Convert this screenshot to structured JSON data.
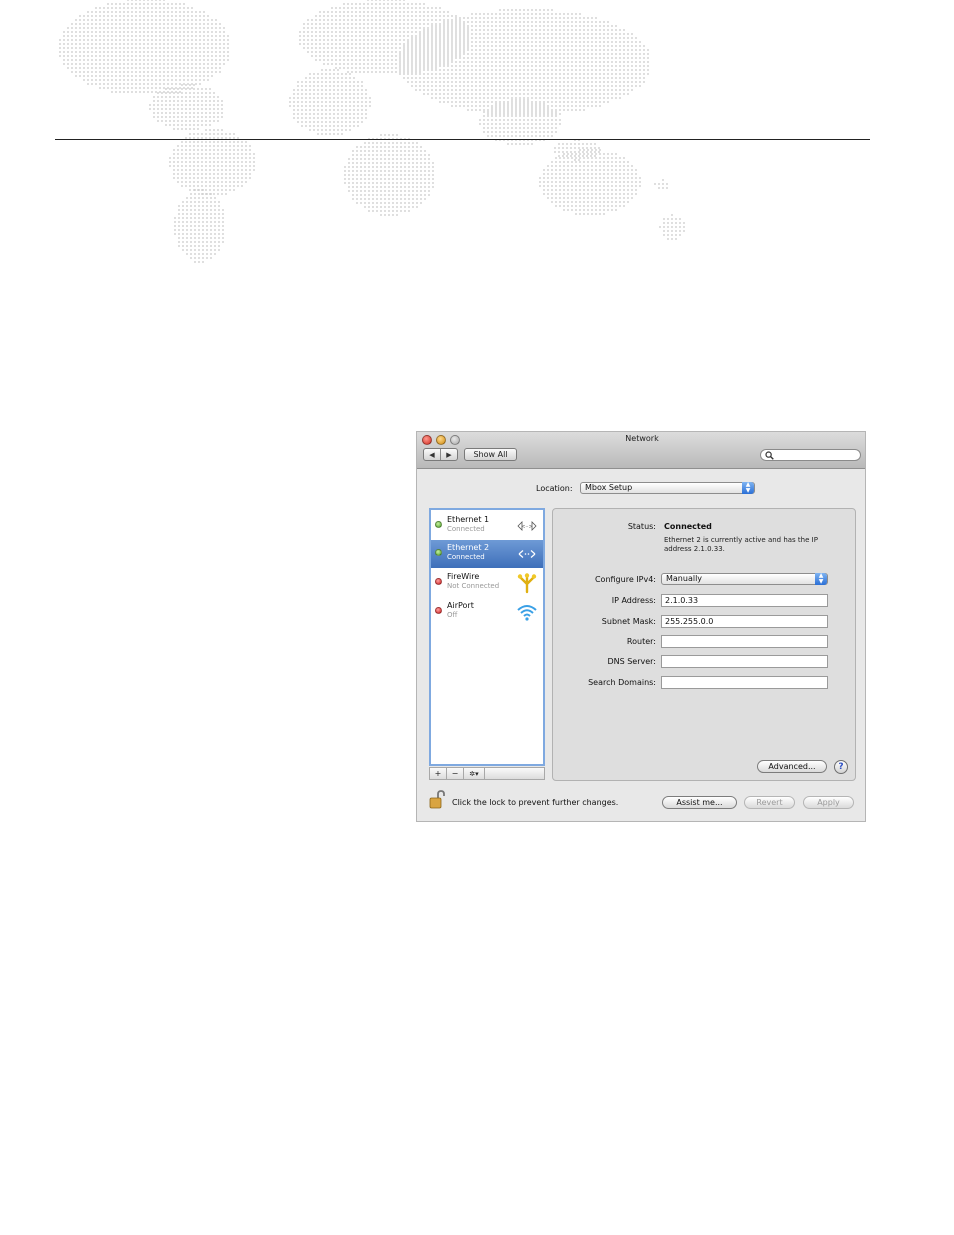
{
  "window": {
    "title": "Network",
    "toolbar": {
      "back": "◀",
      "forward": "▶",
      "show_all": "Show All",
      "search_placeholder": ""
    }
  },
  "location": {
    "label": "Location:",
    "value": "Mbox Setup"
  },
  "services": [
    {
      "name": "Ethernet 1",
      "status": "Connected",
      "indicator": "green",
      "icon": "ethernet-icon",
      "selected": false
    },
    {
      "name": "Ethernet 2",
      "status": "Connected",
      "indicator": "green",
      "icon": "ethernet-icon",
      "selected": true
    },
    {
      "name": "FireWire",
      "status": "Not Connected",
      "indicator": "red",
      "icon": "firewire-icon",
      "selected": false
    },
    {
      "name": "AirPort",
      "status": "Off",
      "indicator": "red",
      "icon": "airport-wifi-icon",
      "selected": false
    }
  ],
  "list_tools": {
    "add": "+",
    "remove": "−",
    "gear": "✲▾"
  },
  "detail": {
    "status_label": "Status:",
    "status_value": "Connected",
    "status_desc": "Ethernet 2 is currently active and has the IP address 2.1.0.33.",
    "configure_label": "Configure IPv4:",
    "configure_value": "Manually",
    "ip_label": "IP Address:",
    "ip_value": "2.1.0.33",
    "subnet_label": "Subnet Mask:",
    "subnet_value": "255.255.0.0",
    "router_label": "Router:",
    "router_value": "",
    "dns_label": "DNS Server:",
    "dns_value": "",
    "search_label": "Search Domains:",
    "search_value": "",
    "advanced": "Advanced...",
    "help": "?"
  },
  "footer": {
    "lock_message": "Click the lock to prevent further changes.",
    "assist": "Assist me...",
    "revert": "Revert",
    "apply": "Apply"
  },
  "colors": {
    "selection": "#3e6fba",
    "list_border": "#7fa9e0",
    "status_green": "#4fa42a",
    "status_red": "#cf1d1d"
  }
}
